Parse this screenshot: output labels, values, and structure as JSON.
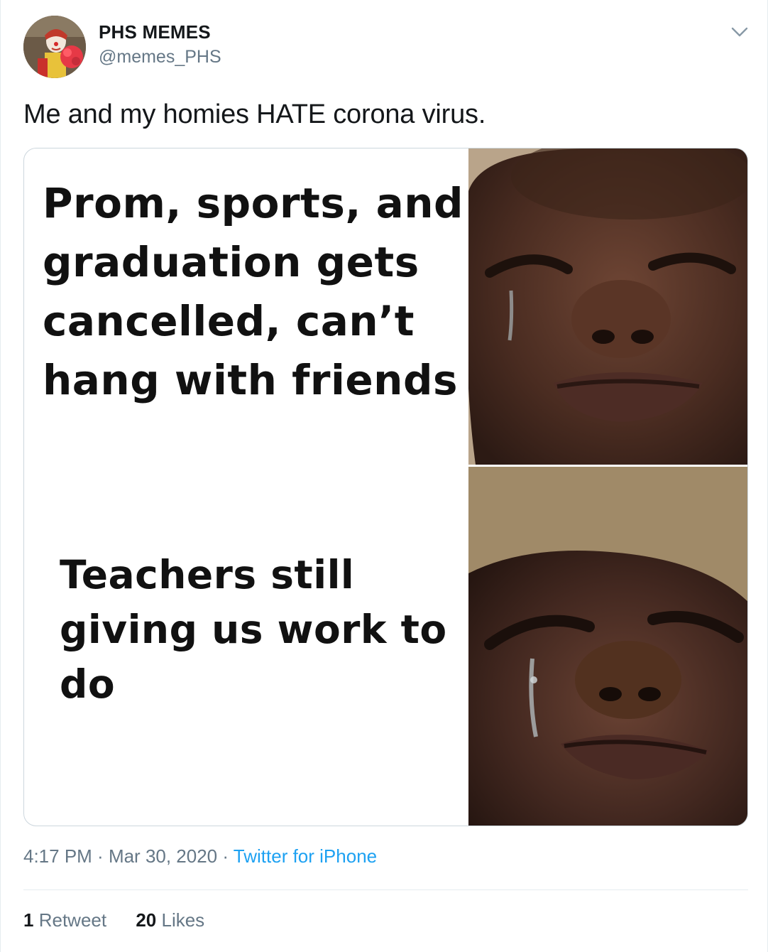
{
  "author": {
    "display_name": "PHS MEMES",
    "handle": "@memes_PHS",
    "avatar_icon": "clown-avatar"
  },
  "menu_icon": "chevron-down-icon",
  "tweet_text": "Me and my homies HATE corona virus.",
  "media": {
    "top_caption": "Prom, sports, and\ngraduation gets\ncancelled, can’t\nhang with friends",
    "bottom_caption": "Teachers still\ngiving us work to\ndo",
    "top_photo": "smiling-face-with-tears",
    "bottom_photo": "crying-face"
  },
  "meta": {
    "time": "4:17 PM",
    "sep1": " · ",
    "date": "Mar 30, 2020",
    "sep2": " · ",
    "source": "Twitter for iPhone"
  },
  "stats": {
    "retweets_count": "1",
    "retweets_label": "Retweet",
    "likes_count": "20",
    "likes_label": "Likes"
  },
  "colors": {
    "link": "#1da1f2",
    "secondary_text": "#657786",
    "primary_text": "#14171a"
  }
}
